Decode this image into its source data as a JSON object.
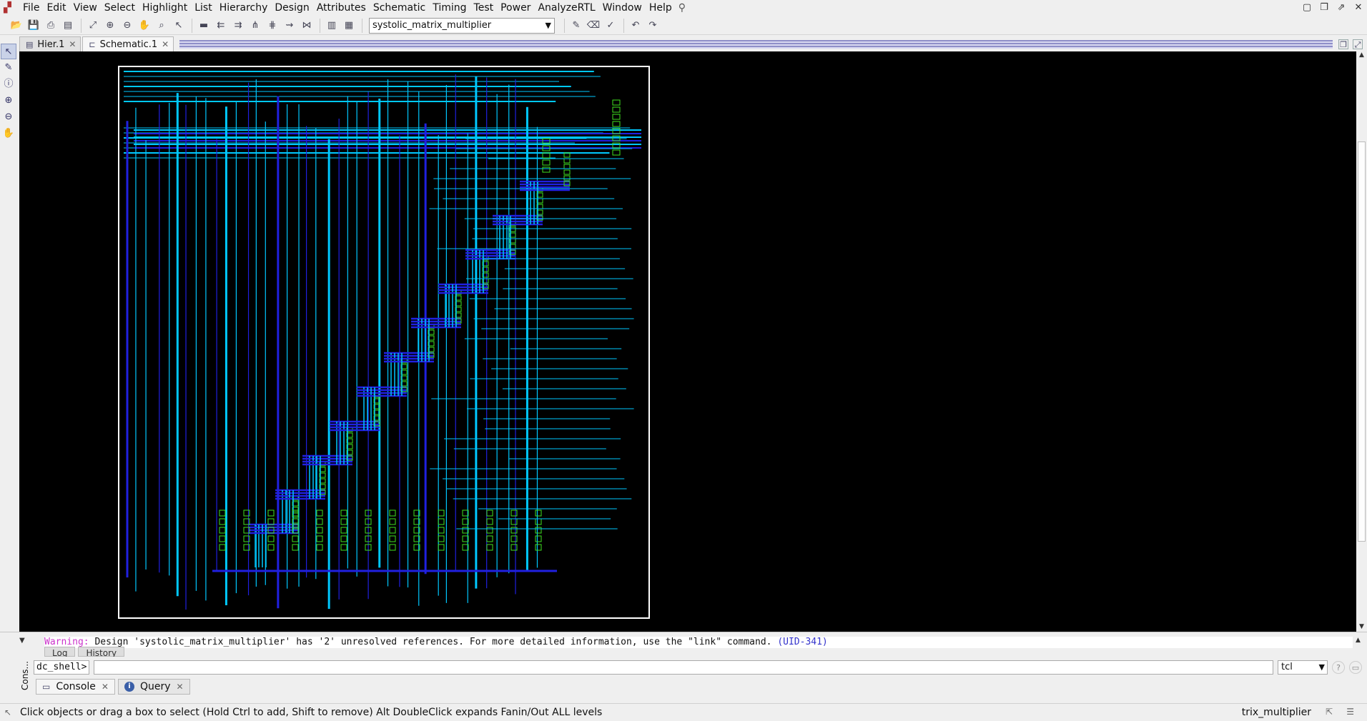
{
  "menubar": {
    "items": [
      "File",
      "Edit",
      "View",
      "Select",
      "Highlight",
      "List",
      "Hierarchy",
      "Design",
      "Attributes",
      "Schematic",
      "Timing",
      "Test",
      "Power",
      "AnalyzeRTL",
      "Window",
      "Help"
    ]
  },
  "toolbar": {
    "design_select_value": "systolic_matrix_multiplier"
  },
  "tabs": [
    {
      "label": "Hier.1",
      "icon": "hierarchy-icon"
    },
    {
      "label": "Schematic.1",
      "icon": "schematic-icon"
    }
  ],
  "console": {
    "warning_label": "Warning:",
    "warning_text": " Design 'systolic_matrix_multiplier' has '2' unresolved references. For more detailed information, use the \"link\" command. ",
    "warning_link": "(UID-341)",
    "sub_tabs": [
      "Log",
      "History"
    ],
    "side_label": "Cons...",
    "prompt": "dc_shell>",
    "input_value": "",
    "shell_value": "tcl"
  },
  "bottom_tabs": [
    {
      "label": "Console",
      "icon": "console-icon"
    },
    {
      "label": "Query",
      "icon": "info-icon"
    }
  ],
  "statusbar": {
    "hint": "Click objects or drag a box to select (Hold Ctrl to add, Shift to remove) Alt DoubleClick expands Fanin/Out ALL levels",
    "design": "trix_multiplier"
  },
  "colors": {
    "canvas_bg": "#000000",
    "frame": "#ffffff",
    "wire_primary": "#00c8ff",
    "wire_secondary": "#2020e0",
    "cell_outline": "#40e020",
    "warning": "#cc33cc",
    "link": "#3333cc"
  }
}
